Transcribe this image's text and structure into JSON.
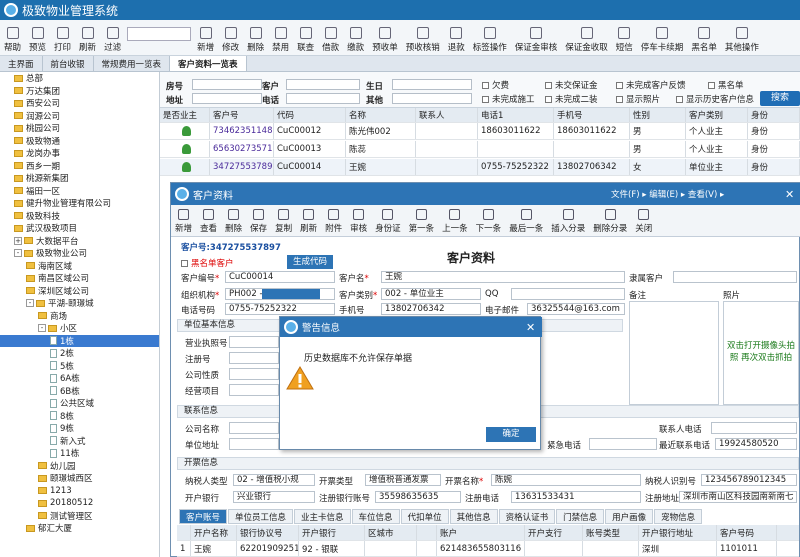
{
  "app": {
    "title": "极致物业管理系统",
    "accent": "#1d6fae"
  },
  "toolbar": [
    "帮助",
    "预览",
    "打印",
    "刷新",
    "过滤",
    "新增",
    "修改",
    "删除",
    "禁用",
    "联查",
    "借款",
    "缴款",
    "预收单",
    "预收核销",
    "退款",
    "标签操作",
    "保证金审核",
    "保证金收取",
    "短信",
    "停车卡续期",
    "黑名单",
    "其他操作"
  ],
  "tabs": [
    "主界面",
    "前台收银",
    "常规费用一览表",
    "客户资料一览表"
  ],
  "tree": [
    {
      "label": "总部",
      "lvl": 1,
      "t": "fold"
    },
    {
      "label": "万达集团",
      "lvl": 1,
      "t": "fold"
    },
    {
      "label": "西安公司",
      "lvl": 1,
      "t": "fold"
    },
    {
      "label": "润源公司",
      "lvl": 1,
      "t": "fold"
    },
    {
      "label": "桃园公司",
      "lvl": 1,
      "t": "fold"
    },
    {
      "label": "极致物通",
      "lvl": 1,
      "t": "fold"
    },
    {
      "label": "龙岗办事",
      "lvl": 1,
      "t": "fold"
    },
    {
      "label": "西乡一期",
      "lvl": 1,
      "t": "fold"
    },
    {
      "label": "桃源新集团",
      "lvl": 1,
      "t": "fold"
    },
    {
      "label": "福田一区",
      "lvl": 1,
      "t": "fold"
    },
    {
      "label": "健升物业管理有限公司",
      "lvl": 1,
      "t": "fold"
    },
    {
      "label": "极致科技",
      "lvl": 1,
      "t": "fold"
    },
    {
      "label": "武汉极致项目",
      "lvl": 1,
      "t": "fold"
    },
    {
      "label": "大数据平台",
      "lvl": 1,
      "t": "fold",
      "exp": "+"
    },
    {
      "label": "极致物业公司",
      "lvl": 1,
      "t": "fold",
      "exp": "-"
    },
    {
      "label": "海南区域",
      "lvl": 2,
      "t": "fold"
    },
    {
      "label": "南昌区域公司",
      "lvl": 2,
      "t": "fold"
    },
    {
      "label": "深圳区域公司",
      "lvl": 2,
      "t": "fold"
    },
    {
      "label": "平湖-颐璟城",
      "lvl": 2,
      "t": "fold",
      "exp": "-"
    },
    {
      "label": "商场",
      "lvl": 3,
      "t": "fold"
    },
    {
      "label": "小区",
      "lvl": 3,
      "t": "fold",
      "exp": "-"
    },
    {
      "label": "1栋",
      "lvl": 4,
      "t": "file",
      "sel": true
    },
    {
      "label": "2栋",
      "lvl": 4,
      "t": "file"
    },
    {
      "label": "5栋",
      "lvl": 4,
      "t": "file"
    },
    {
      "label": "6A栋",
      "lvl": 4,
      "t": "file"
    },
    {
      "label": "6B栋",
      "lvl": 4,
      "t": "file"
    },
    {
      "label": "公共区域",
      "lvl": 4,
      "t": "file"
    },
    {
      "label": "8栋",
      "lvl": 4,
      "t": "file"
    },
    {
      "label": "9栋",
      "lvl": 4,
      "t": "file"
    },
    {
      "label": "新入式",
      "lvl": 4,
      "t": "file"
    },
    {
      "label": "11栋",
      "lvl": 4,
      "t": "file"
    },
    {
      "label": "幼儿园",
      "lvl": 3,
      "t": "fold"
    },
    {
      "label": "颐璟城西区",
      "lvl": 3,
      "t": "fold"
    },
    {
      "label": "1213",
      "lvl": 3,
      "t": "fold"
    },
    {
      "label": "20180512",
      "lvl": 3,
      "t": "fold"
    },
    {
      "label": "测试管理区",
      "lvl": 3,
      "t": "fold"
    },
    {
      "label": "郁汇大厦",
      "lvl": 2,
      "t": "fold"
    }
  ],
  "filter": {
    "l_room": "房号",
    "l_addr": "地址",
    "l_cust": "客户",
    "l_phone": "电话",
    "l_bday": "生日",
    "l_other": "其他",
    "checks": [
      "欠费",
      "未交保证金",
      "未完成客户反馈",
      "黑名单",
      "未完成施工",
      "未完成二装",
      "显示照片",
      "显示历史客户信息"
    ],
    "search": "搜索"
  },
  "grid": {
    "headers": [
      "是否业主",
      "客户号",
      "代码",
      "名称",
      "联系人",
      "电话1",
      "手机号",
      "性别",
      "客户类别",
      "身份"
    ],
    "rows": [
      [
        "",
        "734623511481",
        "CuC00012",
        "陈光伟002",
        "",
        "18603011622",
        "18603011622",
        "男",
        "个人业主",
        "身份"
      ],
      [
        "",
        "656302735716",
        "CuC00013",
        "陈蕊",
        "",
        "",
        "",
        "男",
        "个人业主",
        "身份"
      ],
      [
        "",
        "347275537897",
        "CuC00014",
        "王婉",
        "",
        "0755-75252322",
        "13802706342",
        "女",
        "单位业主",
        "身份"
      ]
    ]
  },
  "dialog": {
    "title": "客户资料",
    "menu": "文件(F) ▸  编辑(E) ▸  查看(V) ▸",
    "toolbar": [
      "新增",
      "查看",
      "删除",
      "保存",
      "复制",
      "刷新",
      "附件",
      "审核",
      "身份证",
      "第一条",
      "上一条",
      "下一条",
      "最后一条",
      "插入分录",
      "删除分录",
      "关闭"
    ],
    "custno": "客户号:347275537897",
    "heading": "客户资料",
    "blacklist": "黑名单客户",
    "gen": "生成代码",
    "f": {
      "l_code": "客户编号",
      "code": "CuC00014",
      "l_name": "客户名",
      "name": "王婉",
      "l_org": "组织机构",
      "org": "PH002 -",
      "l_type": "客户类别",
      "type": "002 - 单位业主",
      "l_qq": "QQ",
      "l_tel": "电话号码",
      "tel": "0755-75252322",
      "l_mob": "手机号",
      "mob": "13802706342",
      "l_mail": "电子邮件",
      "mail": "36325544@163.com",
      "l_parent": "隶属客户",
      "l_note": "备注",
      "l_photo": "照片",
      "photo_hint": "双击打开摄像头拍照 再次双击抓拍"
    },
    "s_basic": "单位基本信息",
    "basic": [
      "营业执照号",
      "注册号",
      "公司性质",
      "经营项目"
    ],
    "s_contact": "联系信息",
    "l_company": "公司名称",
    "l_unitaddr": "单位地址",
    "l_person": "联系人电话",
    "l_emer": "紧急电话",
    "l_recent": "最近联系电话",
    "recent": "19924580520",
    "s_inv": "开票信息",
    "l_taxer": "纳税人类型",
    "taxer": "02 - 增值税小规",
    "l_invtype": "开票类型",
    "invtype": "增值税普通发票",
    "l_invname": "开票名称",
    "invname": "陈婉",
    "l_taxid": "纳税人识别号",
    "taxid": "123456789012345",
    "l_bank": "开户银行",
    "bank": "兴业银行",
    "l_regacct": "注册银行账号",
    "regacct": "35598635635",
    "l_regtel": "注册电话",
    "regtel": "13631533431",
    "l_regaddr": "注册地址",
    "regaddr": "深圳市南山区科技园南新南七",
    "btabs": [
      "客户账号",
      "单位员工信息",
      "业主卡信息",
      "车位信息",
      "代扣单位",
      "其他信息",
      "资格认证书",
      "门禁信息",
      "用户画像",
      "宠物信息"
    ],
    "bhead": [
      "",
      "开户名称",
      "银行协议号",
      "开户银行",
      "区城市",
      "",
      "账户",
      "开户支行",
      "账号类型",
      "开户银行地址",
      "客户号码"
    ],
    "brow": [
      "1",
      "王婉",
      "622019092511",
      "92 - 银联",
      "",
      "",
      "621483655803116",
      "",
      "",
      "深圳",
      "1101011"
    ]
  },
  "alert": {
    "title": "警告信息",
    "msg": "历史数据库不允许保存单据",
    "ok": "确定"
  }
}
